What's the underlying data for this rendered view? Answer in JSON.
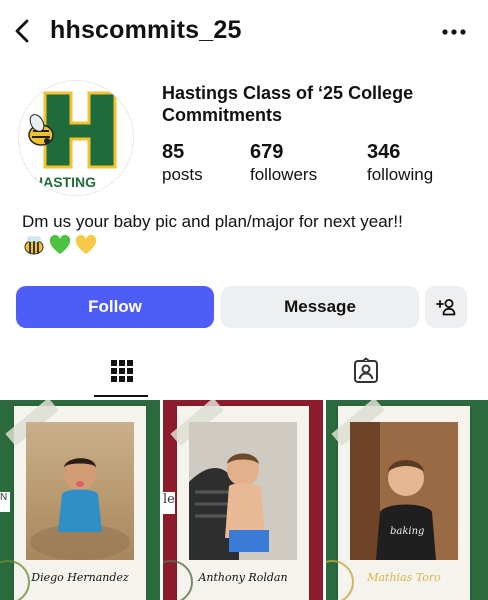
{
  "header": {
    "username": "hhscommits_25"
  },
  "avatar": {
    "letter": "H",
    "wordmark": "HASTING"
  },
  "profile": {
    "name": "Hastings Class of ‘25 College Commitments",
    "stats": [
      {
        "value": "85",
        "label": "posts"
      },
      {
        "value": "679",
        "label": "followers"
      },
      {
        "value": "346",
        "label": "following"
      }
    ],
    "bio": "Dm us your baby pic and plan/major for next year!!",
    "bio_emojis": [
      "bee-emoji",
      "green-heart-emoji",
      "yellow-heart-emoji"
    ]
  },
  "actions": {
    "follow_label": "Follow",
    "message_label": "Message"
  },
  "colors": {
    "follow_blue": "#4e5df6",
    "button_gray": "#eeeff1",
    "school_green": "#1f6b3a",
    "school_gold": "#f1c232",
    "card_maroon": "#8e1b2c",
    "card_green": "#2b6a3c"
  },
  "posts": [
    {
      "caption": "Diego Hernandez",
      "side_text": "N"
    },
    {
      "caption": "Anthony Roldan",
      "side_text": "le"
    },
    {
      "caption": "Mathias Toro",
      "side_text": ""
    }
  ]
}
